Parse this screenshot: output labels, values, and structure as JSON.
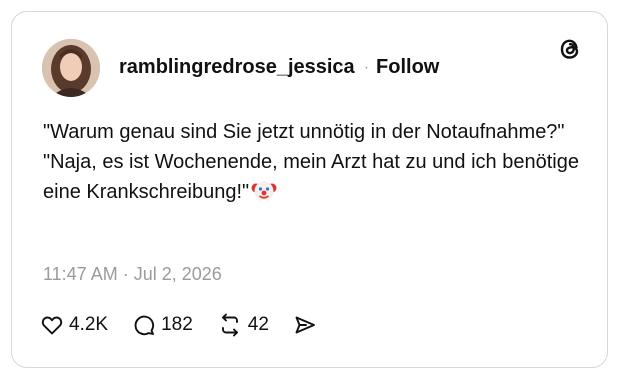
{
  "post": {
    "username": "ramblingredrose_jessica",
    "separator": "·",
    "follow_label": "Follow",
    "lines": [
      "\"Warum genau sind Sie jetzt unnötig in der Notaufnahme?\"",
      "\"Naja, es ist Wochenende, mein Arzt hat zu und ich benötige eine Krankschreibung!\""
    ],
    "emoji": "clown-face-emoji",
    "timestamp": "11:47 AM · Jul 2, 2026"
  },
  "actions": {
    "likes": "4.2K",
    "replies": "182",
    "reposts": "42"
  },
  "icons": {
    "logo": "threads-logo-icon",
    "like": "heart-icon",
    "reply": "speech-bubble-icon",
    "repost": "repost-icon",
    "share": "paper-plane-icon"
  },
  "colors": {
    "text": "#111111",
    "muted": "#9b9b9b",
    "border": "#d7d7d7"
  }
}
